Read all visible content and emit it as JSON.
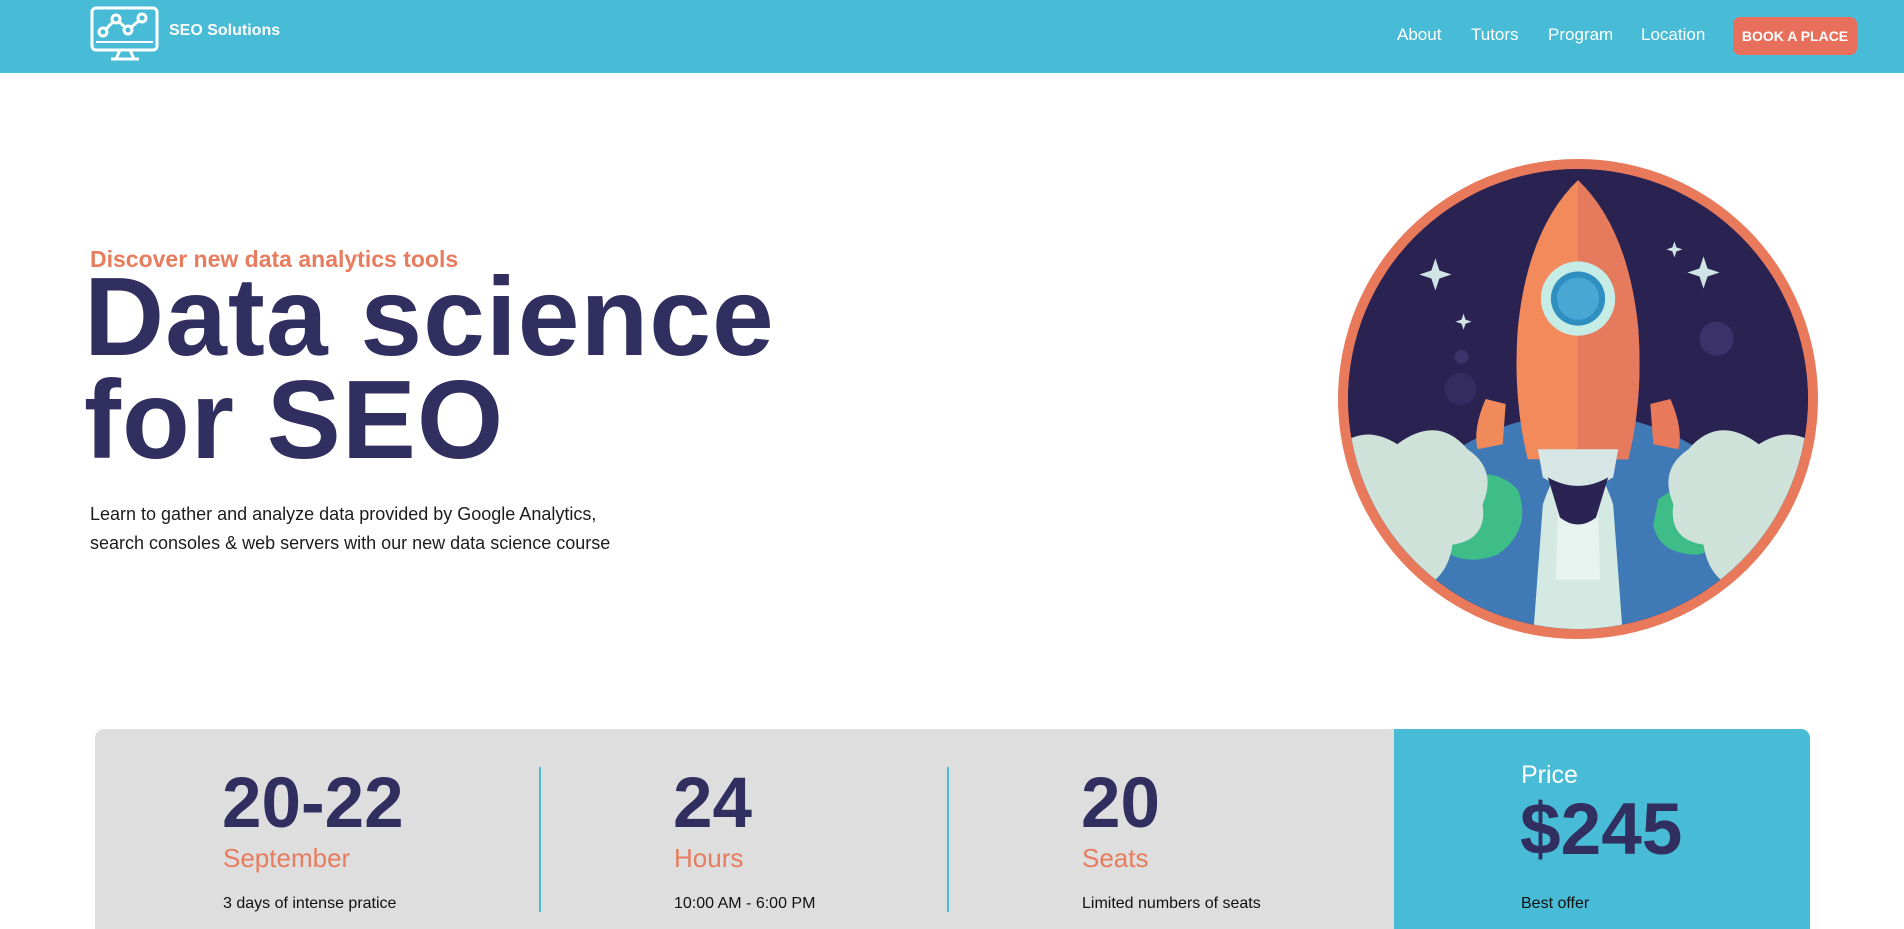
{
  "header": {
    "brand": "SEO Solutions",
    "logo_icon": "monitor-chart-icon",
    "nav": [
      "About",
      "Tutors",
      "Program",
      "Location"
    ],
    "cta_label": "BOOK A PLACE"
  },
  "hero": {
    "eyebrow": "Discover new data analytics tools",
    "title_line1": "Data science",
    "title_line2": "for SEO",
    "description_line1": "Learn to gather and analyze data provided by Google Analytics,",
    "description_line2": "search consoles & web servers with our new data science course",
    "illustration_icon": "rocket-launch-icon"
  },
  "stats": [
    {
      "number": "20-22",
      "label": "September",
      "description": "3 days of intense pratice"
    },
    {
      "number": "24",
      "label": "Hours",
      "description": "10:00 AM - 6:00 PM"
    },
    {
      "number": "20",
      "label": "Seats",
      "description": "Limited numbers of seats"
    }
  ],
  "price": {
    "label": "Price",
    "value": "$245",
    "description": "Best offer"
  },
  "colors": {
    "header_bg": "#48bbd6",
    "accent_coral": "#e86f5c",
    "text_orange": "#e77c5e",
    "navy": "#312e60",
    "stats_bg": "#dedede"
  }
}
